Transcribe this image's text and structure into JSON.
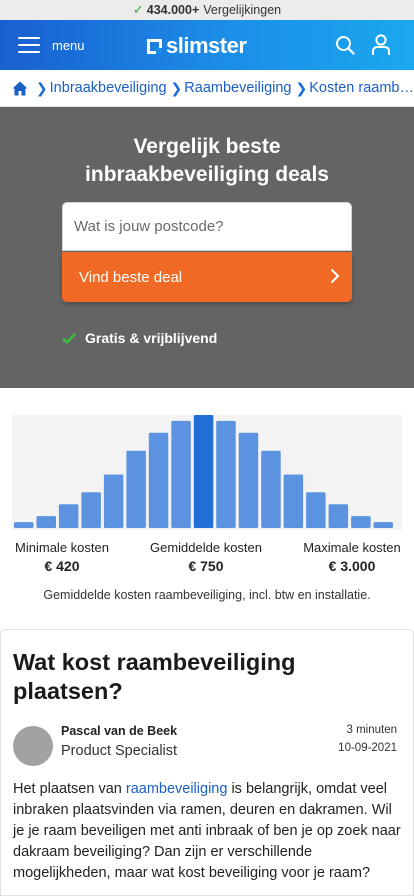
{
  "topbar": {
    "count": "434.000+",
    "label": "Vergelijkingen"
  },
  "header": {
    "menu_label": "menu",
    "logo_text": "slimster",
    "icons": [
      "menu-icon",
      "search-icon",
      "user-icon"
    ]
  },
  "breadcrumb": [
    "Inbraakbeveiliging",
    "Raambeveiliging",
    "Kosten raamb…"
  ],
  "hero": {
    "title_line1": "Vergelijk beste",
    "title_line2": "inbraakbeveiliging deals",
    "postcode_placeholder": "Wat is jouw postcode?",
    "button_label": "Vind beste deal",
    "free_label": "Gratis & vrijblijvend"
  },
  "chart_data": {
    "type": "bar",
    "values": [
      1,
      2,
      4,
      6,
      9,
      13,
      16,
      18,
      19,
      18,
      16,
      13,
      9,
      6,
      4,
      2,
      1
    ],
    "highlight_index": 8,
    "colors": {
      "bar": "#5b93e0",
      "highlight": "#1f6fd6",
      "bg": "#f3f3f3"
    }
  },
  "costs": {
    "min_label": "Minimale kosten",
    "min_value": "€ 420",
    "avg_label": "Gemiddelde kosten",
    "avg_value": "€ 750",
    "max_label": "Maximale kosten",
    "max_value": "€ 3.000",
    "note": "Gemiddelde kosten raambeveiliging, incl. btw en installatie."
  },
  "article": {
    "title": "Wat kost raambeveiliging plaatsen?",
    "author_name": "Pascal van de Beek",
    "author_role": "Product Specialist",
    "read_time": "3 minuten",
    "date": "10-09-2021",
    "text_before_link": "Het plaatsen van ",
    "link_text": "raambeveiliging",
    "text_after_link": " is belangrijk, omdat veel inbraken plaatsvinden via ramen, deuren en dakramen. Wil je je raam beveiligen met anti inbraak of ben je op zoek naar dakraam beveiliging? Dan zijn er verschillende mogelijkheden, maar wat kost beveiliging voor je raam?"
  }
}
